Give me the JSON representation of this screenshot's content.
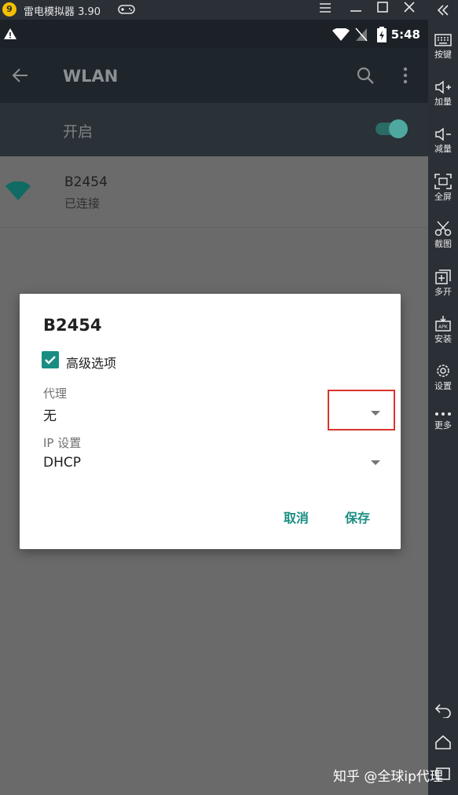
{
  "emulator": {
    "logo_glyph": "9",
    "title": "雷电模拟器 3.90",
    "sidebar": {
      "items": [
        {
          "label": "按键",
          "icon": "keyboard-icon"
        },
        {
          "label": "加量",
          "icon": "volume-up-icon"
        },
        {
          "label": "减量",
          "icon": "volume-down-icon"
        },
        {
          "label": "全屏",
          "icon": "fullscreen-icon"
        },
        {
          "label": "截图",
          "icon": "scissors-icon"
        },
        {
          "label": "多开",
          "icon": "multi-open-icon"
        },
        {
          "label": "安装",
          "icon": "apk-install-icon"
        },
        {
          "label": "设置",
          "icon": "gear-icon"
        },
        {
          "label": "更多",
          "icon": "more-dots-icon"
        }
      ]
    }
  },
  "status_bar": {
    "time": "5:48"
  },
  "app_bar": {
    "title": "WLAN"
  },
  "wifi_switch": {
    "label": "开启",
    "on": true
  },
  "network": {
    "name": "B2454",
    "status": "已连接"
  },
  "dialog": {
    "title": "B2454",
    "advanced_label": "高级选项",
    "advanced_checked": true,
    "proxy_label": "代理",
    "proxy_value": "无",
    "ip_label": "IP 设置",
    "ip_value": "DHCP",
    "cancel_label": "取消",
    "save_label": "保存"
  },
  "watermark": "知乎 @全球ip代理",
  "colors": {
    "accent": "#1a8d82",
    "highlight_box": "#d9342b"
  }
}
